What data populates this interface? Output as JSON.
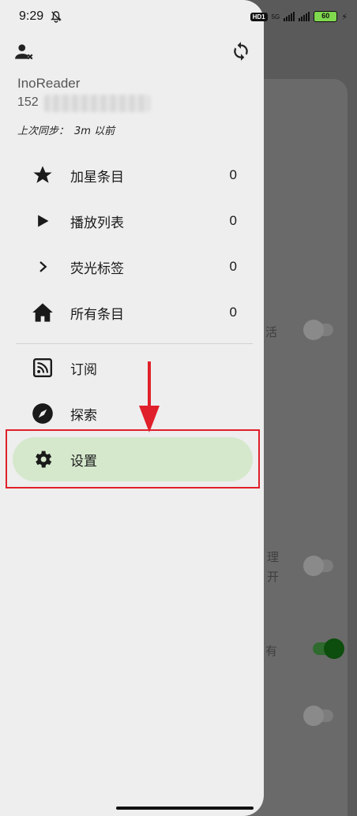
{
  "status_bar": {
    "time": "9:29",
    "network_badge": "HD1",
    "network_type": "5G",
    "battery": "60"
  },
  "drawer": {
    "account": {
      "name": "InoReader",
      "id_visible": "152",
      "sync_label": "上次同步：",
      "sync_value": "3m 以前"
    },
    "items": [
      {
        "icon": "star-icon",
        "label": "加星条目",
        "count": "0"
      },
      {
        "icon": "play-icon",
        "label": "播放列表",
        "count": "0"
      },
      {
        "icon": "chevron-right-icon",
        "label": "荧光标签",
        "count": "0"
      },
      {
        "icon": "home-icon",
        "label": "所有条目",
        "count": "0"
      },
      {
        "icon": "rss-icon",
        "label": "订阅"
      },
      {
        "icon": "compass-icon",
        "label": "探索"
      },
      {
        "icon": "gear-icon",
        "label": "设置",
        "active": true
      }
    ],
    "active_color": "#d5e8cc"
  },
  "background": {
    "fragments": [
      "活",
      "理",
      "开",
      "有"
    ],
    "toggles": [
      "off",
      "off",
      "on",
      "off"
    ]
  },
  "annotation": {
    "color": "#e0202a"
  }
}
